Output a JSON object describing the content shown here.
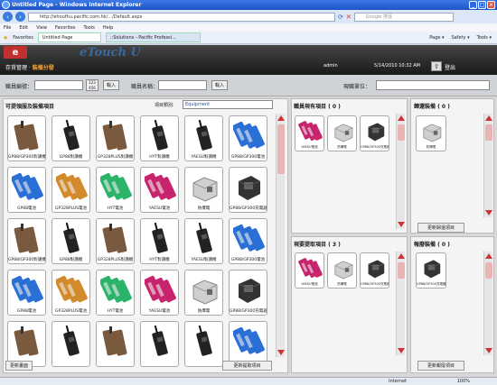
{
  "browser": {
    "title": "Untitled Page - Windows Internet Explorer",
    "address": "http://ehoufhu.pacific.com.hk/.../Default.aspx",
    "search_placeholder": "Google 搜尋",
    "menu": [
      "File",
      "Edit",
      "View",
      "Favorites",
      "Tools",
      "Help"
    ],
    "favorites_label": "Favorites",
    "tabs": [
      "Untitled Page",
      "::Solutions - Pacific Professi..."
    ],
    "tools": [
      "Page ▾",
      "Safety ▾",
      "Tools ▾"
    ],
    "status_internet": "Internet",
    "status_zoom": "100%"
  },
  "app": {
    "logo": "eTouch U",
    "breadcrumb_root": "存貨管理 ·",
    "breadcrumb_current": "裝備分發",
    "user": "admin",
    "datetime": "5/14/2010 10:32 AM",
    "logout": "登出"
  },
  "filter": {
    "staff_id_label": "職員編號：",
    "staff_name_label": "職員名稱：",
    "dept_label": "現職單位：",
    "enter_btn": "輸入",
    "enter_btn2": "輸入"
  },
  "catalog": {
    "title": "可提領服及裝備項目",
    "category_label": "項目類別:",
    "category_value": "Equipment",
    "refresh_btn": "更新畫面",
    "update_btn": "更新提取項目",
    "items": [
      {
        "label": "GP88/GP300對講機",
        "kind": "pouch",
        "color": "#7a5a3e"
      },
      {
        "label": "GP88對講機",
        "kind": "radio",
        "color": "#222"
      },
      {
        "label": "GP328PLUS對講機",
        "kind": "pouch",
        "color": "#7a5a3e"
      },
      {
        "label": "HYT對講機",
        "kind": "radio",
        "color": "#222"
      },
      {
        "label": "YAESU對講機",
        "kind": "radio",
        "color": "#222"
      },
      {
        "label": "GP88/GP300電池",
        "kind": "battery",
        "color": "#2a6fd6"
      },
      {
        "label": "GP88電池",
        "kind": "battery",
        "color": "#2a6fd6"
      },
      {
        "label": "GP328PLUS電池",
        "kind": "battery",
        "color": "#d38a2a"
      },
      {
        "label": "HYT電池",
        "kind": "battery",
        "color": "#2bb36a"
      },
      {
        "label": "YAESU電池",
        "kind": "battery",
        "color": "#c8246e"
      },
      {
        "label": "防爆電",
        "kind": "box",
        "color": "#999"
      },
      {
        "label": "GP88/GP300充電器",
        "kind": "charger",
        "color": "#333"
      },
      {
        "label": "GP88/GP300對講機",
        "kind": "pouch",
        "color": "#7a5a3e"
      },
      {
        "label": "GP88對講機",
        "kind": "radio",
        "color": "#222"
      },
      {
        "label": "GP328PLUS對講機",
        "kind": "pouch",
        "color": "#7a5a3e"
      },
      {
        "label": "HYT對講機",
        "kind": "radio",
        "color": "#222"
      },
      {
        "label": "YAESU對講機",
        "kind": "radio",
        "color": "#222"
      },
      {
        "label": "GP88/GP300電池",
        "kind": "battery",
        "color": "#2a6fd6"
      },
      {
        "label": "GP88電池",
        "kind": "battery",
        "color": "#2a6fd6"
      },
      {
        "label": "GP328PLUS電池",
        "kind": "battery",
        "color": "#d38a2a"
      },
      {
        "label": "HYT電池",
        "kind": "battery",
        "color": "#2bb36a"
      },
      {
        "label": "YAESU電池",
        "kind": "battery",
        "color": "#c8246e"
      },
      {
        "label": "防爆電",
        "kind": "box",
        "color": "#999"
      },
      {
        "label": "GP88/GP300充電器",
        "kind": "charger",
        "color": "#333"
      },
      {
        "label": "",
        "kind": "pouch",
        "color": "#7a5a3e"
      },
      {
        "label": "",
        "kind": "radio",
        "color": "#222"
      },
      {
        "label": "",
        "kind": "pouch",
        "color": "#7a5a3e"
      },
      {
        "label": "",
        "kind": "radio",
        "color": "#222"
      },
      {
        "label": "",
        "kind": "radio",
        "color": "#222"
      },
      {
        "label": "",
        "kind": "battery",
        "color": "#2a6fd6"
      }
    ]
  },
  "owned": {
    "title": "職員現有項目 ( 0 )",
    "items": [
      {
        "label": "YAESU電池",
        "kind": "battery",
        "color": "#c8246e"
      },
      {
        "label": "防爆電",
        "kind": "box",
        "color": "#999"
      },
      {
        "label": "GP88/GP300充電器",
        "kind": "charger",
        "color": "#333"
      }
    ]
  },
  "pickup": {
    "title": "現要提取項目 ( 3 )",
    "items": [
      {
        "label": "YAESU電池",
        "kind": "battery",
        "color": "#c8246e"
      },
      {
        "label": "防爆電",
        "kind": "box",
        "color": "#999"
      },
      {
        "label": "GP88/GP300充電器",
        "kind": "charger",
        "color": "#333"
      }
    ]
  },
  "returned": {
    "title": "歸還裝備 ( 0 )",
    "items": [
      {
        "label": "防爆電",
        "kind": "box",
        "color": "#999"
      }
    ],
    "update_btn": "更新歸還項目"
  },
  "damaged": {
    "title": "報廢裝備 ( 0 )",
    "items": [
      {
        "label": "GP88/GP300充電器",
        "kind": "charger",
        "color": "#333"
      }
    ],
    "update_btn": "更新報廢項目"
  }
}
